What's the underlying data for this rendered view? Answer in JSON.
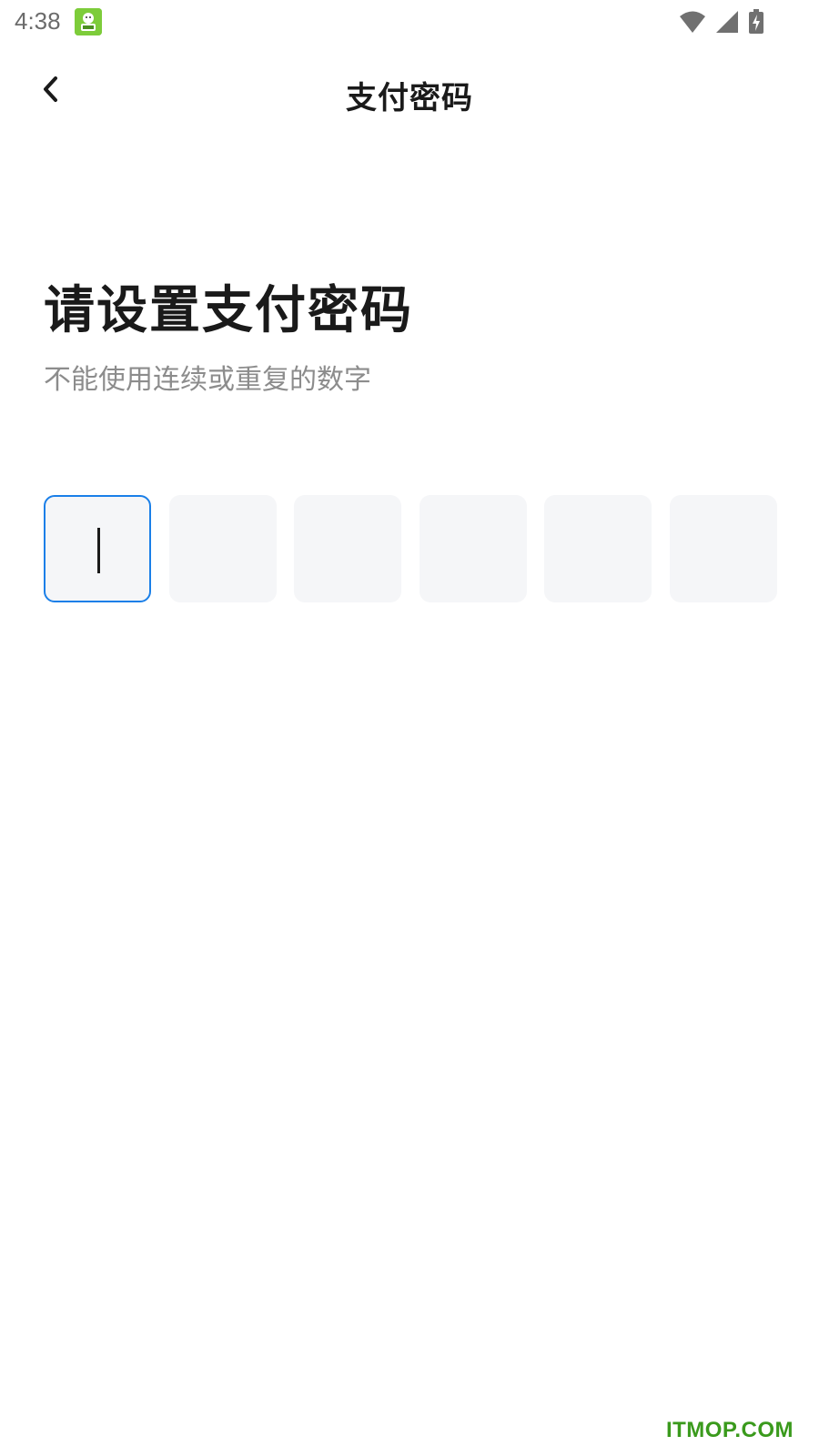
{
  "status_bar": {
    "time": "4:38",
    "icons": [
      "app-notification-icon",
      "wifi-icon",
      "cellular-signal-icon",
      "battery-charging-icon"
    ]
  },
  "header": {
    "title": "支付密码",
    "back_icon": "chevron-left-icon"
  },
  "main": {
    "title": "请设置支付密码",
    "subtitle": "不能使用连续或重复的数字",
    "pin": {
      "length": 6,
      "filled": 0,
      "active_index": 0
    }
  },
  "colors": {
    "accent": "#1a7fe8",
    "box_bg": "#f5f6f8",
    "title": "#1a1a1a",
    "subtitle": "#8c8c8c",
    "watermark": "#3a9a1c"
  },
  "watermark": "ITMOP.COM"
}
